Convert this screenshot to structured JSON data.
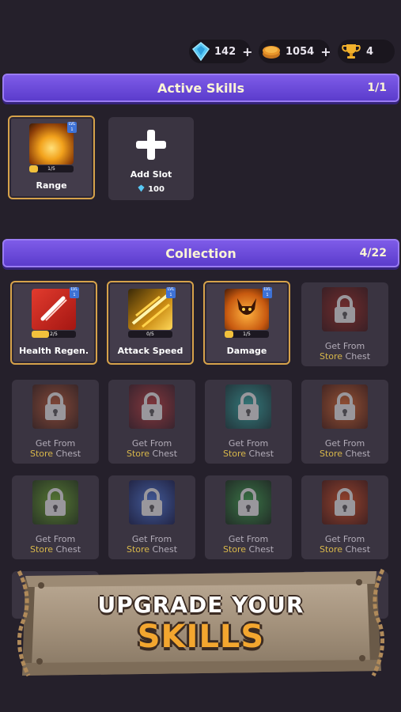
{
  "resources": {
    "gems": "142",
    "coins": "1054",
    "trophies": "4",
    "plus": "+"
  },
  "active_section": {
    "title": "Active Skills",
    "count": "1/1"
  },
  "active_skills": [
    {
      "name": "Range",
      "progress": "1/5",
      "progress_fraction": 0.2,
      "level": "LVL 1"
    }
  ],
  "add_slot": {
    "plus": "+",
    "label": "Add Slot",
    "cost": "100"
  },
  "collection_section": {
    "title": "Collection",
    "count": "4/22"
  },
  "collection": {
    "owned": [
      {
        "name": "Health Regen.",
        "progress": "2/5",
        "progress_fraction": 0.4,
        "level": "LVL 1"
      },
      {
        "name": "Attack Speed",
        "progress": "0/5",
        "progress_fraction": 0.0,
        "level": "LVL 1"
      },
      {
        "name": "Damage",
        "progress": "1/5",
        "progress_fraction": 0.2,
        "level": "LVL 1"
      }
    ],
    "locked_label": {
      "line1": "Get From",
      "store": "Store",
      "chest": "Chest"
    }
  },
  "banner": {
    "line1": "UPGRADE YOUR",
    "line2": "SKILLS"
  },
  "colors": {
    "accent": "#6b4ad8",
    "gold_border": "#d6a24a",
    "store_text": "#d8b74a",
    "banner_orange": "#f3a62f"
  },
  "icons": [
    "gem-icon",
    "coin-icon",
    "trophy-icon",
    "plus-icon",
    "lock-icon"
  ]
}
